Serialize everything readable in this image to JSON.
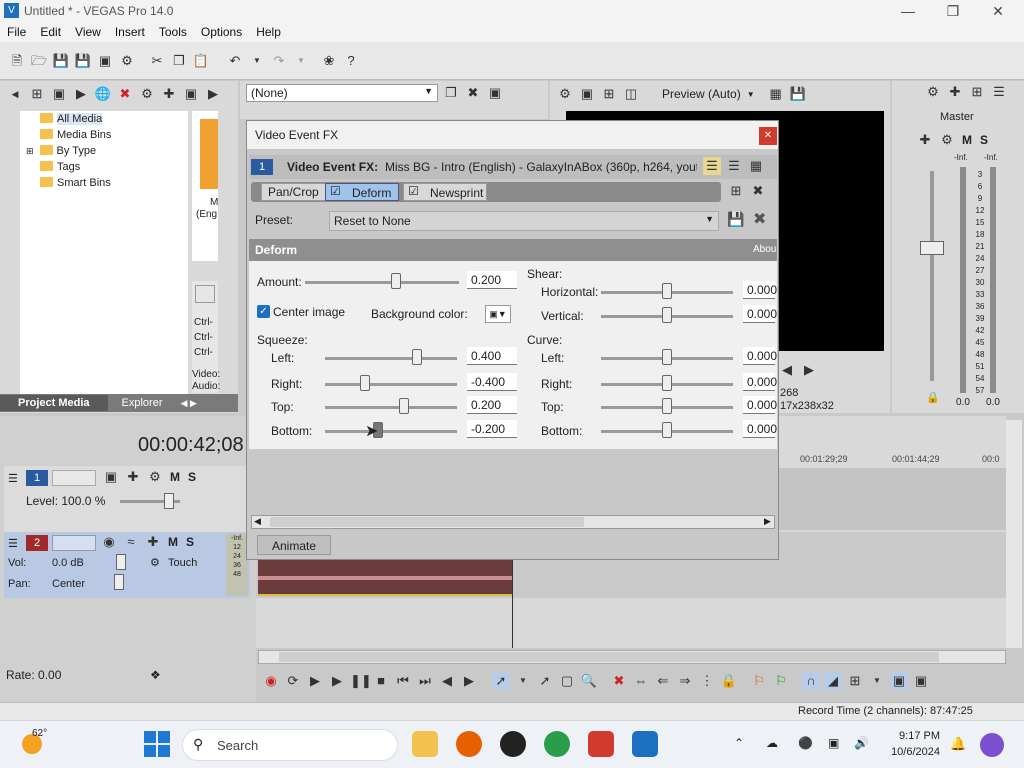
{
  "window": {
    "title": "Untitled * - VEGAS Pro 14.0"
  },
  "menu": [
    "File",
    "Edit",
    "View",
    "Insert",
    "Tools",
    "Options",
    "Help"
  ],
  "fxchain": {
    "value": "(None)"
  },
  "preview": {
    "mode": "Preview (Auto)",
    "coord": "268",
    "size": "17x238x32"
  },
  "mixer": {
    "label": "Master",
    "inf": "-Inf.",
    "scale": [
      "3",
      "6",
      "9",
      "12",
      "15",
      "18",
      "21",
      "24",
      "27",
      "30",
      "33",
      "36",
      "39",
      "42",
      "45",
      "48",
      "51",
      "54",
      "57"
    ],
    "left_val": "0.0",
    "right_val": "0.0"
  },
  "media": {
    "tree": [
      "All Media",
      "Media Bins",
      "By Type",
      "Tags",
      "Smart Bins"
    ],
    "thumb_label": "M",
    "thumb_sub": "(Eng",
    "ctrl": [
      "Ctrl-",
      "Ctrl-",
      "Ctrl-"
    ],
    "video": "Video:",
    "audio": "Audio:",
    "tabs": [
      "Project Media",
      "Explorer"
    ]
  },
  "timecode": "00:00:42;08",
  "tracks": {
    "video": {
      "num": "1",
      "level": "Level: 100.0 %"
    },
    "audio": {
      "num": "2",
      "vol_label": "Vol:",
      "vol": "0.0 dB",
      "pan_label": "Pan:",
      "pan": "Center",
      "touch": "Touch",
      "meter": [
        "12",
        "24",
        "36",
        "48"
      ],
      "inf": "-Inf."
    }
  },
  "ruler": [
    "00:01:29;29",
    "00:01:44;29",
    "00:0"
  ],
  "rate": "Rate: 0.00",
  "status": "Record Time (2 channels): 87:47:25",
  "dialog": {
    "title": "Video Event FX",
    "fx_prefix": "Video Event FX:",
    "fx_name": "Miss BG - Intro (English) - GalaxyInABox (360p, h264, youtub",
    "track_no": "1",
    "chain": [
      "Pan/Crop",
      "Deform",
      "Newsprint"
    ],
    "preset_label": "Preset:",
    "preset": "Reset to None",
    "section": "Deform",
    "about": "Abou",
    "amount": {
      "label": "Amount:",
      "value": "0.200",
      "pos": 0.59
    },
    "center": {
      "label": "Center image",
      "checked": true
    },
    "bg": {
      "label": "Background color:"
    },
    "squeeze": {
      "label": "Squeeze:",
      "rows": [
        {
          "label": "Left:",
          "value": "0.400",
          "pos": 0.7
        },
        {
          "label": "Right:",
          "value": "-0.400",
          "pos": 0.3
        },
        {
          "label": "Top:",
          "value": "0.200",
          "pos": 0.6
        },
        {
          "label": "Bottom:",
          "value": "-0.200",
          "pos": 0.4
        }
      ]
    },
    "shear": {
      "label": "Shear:",
      "rows": [
        {
          "label": "Horizontal:",
          "value": "0.000",
          "pos": 0.5
        },
        {
          "label": "Vertical:",
          "value": "0.000",
          "pos": 0.5
        }
      ]
    },
    "curve": {
      "label": "Curve:",
      "rows": [
        {
          "label": "Left:",
          "value": "0.000",
          "pos": 0.5
        },
        {
          "label": "Right:",
          "value": "0.000",
          "pos": 0.5
        },
        {
          "label": "Top:",
          "value": "0.000",
          "pos": 0.5
        },
        {
          "label": "Bottom:",
          "value": "0.000",
          "pos": 0.5
        }
      ]
    },
    "animate": "Animate"
  },
  "taskbar": {
    "temp": "62°",
    "search": "Search",
    "time": "9:17 PM",
    "date": "10/6/2024"
  }
}
